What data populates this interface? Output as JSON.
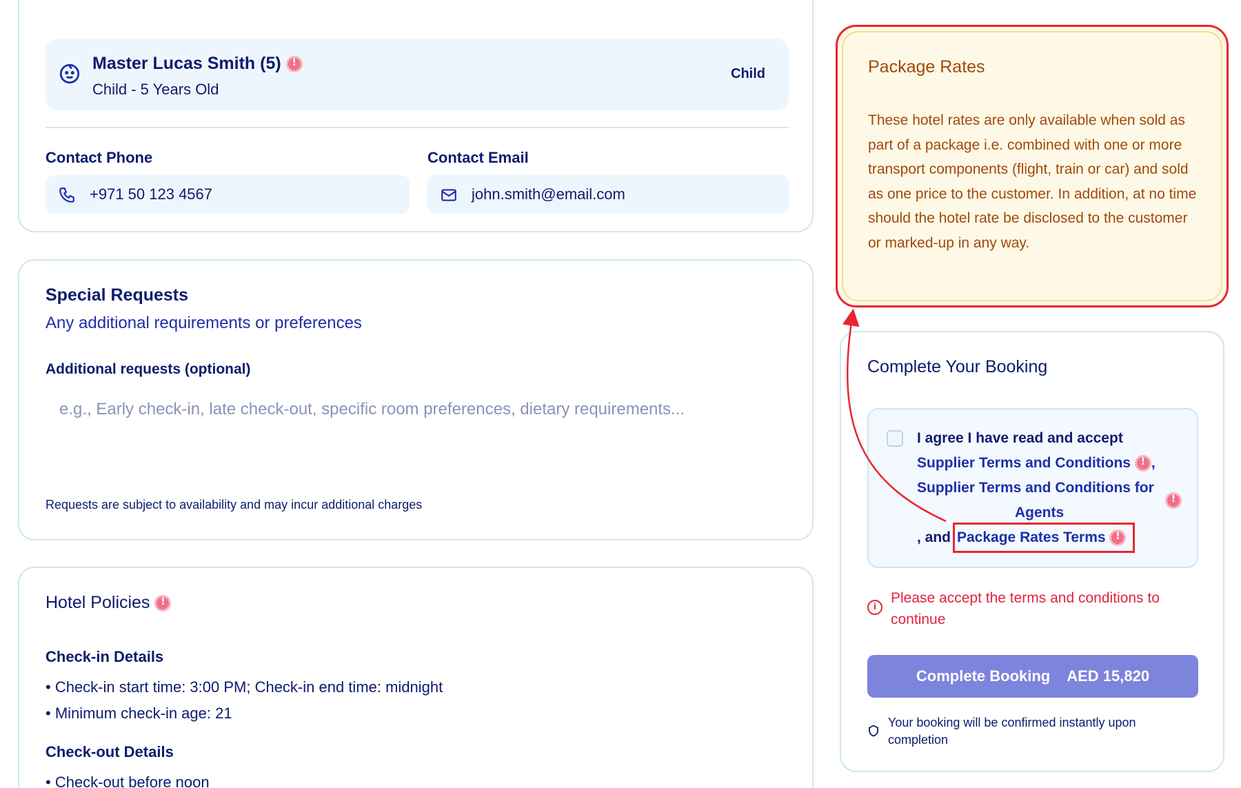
{
  "traveler": {
    "child_name": "Master Lucas Smith (5)",
    "child_subtitle": "Child - 5 Years Old",
    "child_badge": "Child",
    "contact_phone_label": "Contact Phone",
    "contact_phone_value": "+971 50 123 4567",
    "contact_email_label": "Contact Email",
    "contact_email_value": "john.smith@email.com"
  },
  "special_requests": {
    "title": "Special Requests",
    "subtitle": "Any additional requirements or preferences",
    "field_label": "Additional requests (optional)",
    "placeholder": "e.g., Early check-in, late check-out, specific room preferences, dietary requirements...",
    "note": "Requests are subject to availability and may incur additional charges"
  },
  "hotel_policies": {
    "title": "Hotel Policies",
    "checkin_heading": "Check-in Details",
    "checkin_items": [
      "• Check-in start time: 3:00 PM; Check-in end time: midnight",
      "• Minimum check-in age: 21"
    ],
    "checkout_heading": "Check-out Details",
    "checkout_items": [
      "• Check-out before noon"
    ]
  },
  "package_rates": {
    "title": "Package Rates",
    "body": "These hotel rates are only available when sold as part of a package i.e. combined with one or more transport components (flight, train or car) and sold as one price to the customer. In addition, at no time should the hotel rate be disclosed to the customer or marked-up in any way."
  },
  "booking": {
    "title": "Complete Your Booking",
    "agree_text": "I agree I have read and accept",
    "supplier_terms": "Supplier Terms and Conditions",
    "comma": ",",
    "agent_terms_line1": "Supplier Terms and Conditions for",
    "agent_terms_line2": "Agents",
    "and_text": ", and",
    "package_terms": "Package Rates Terms",
    "error_text": "Please accept the terms and conditions to continue",
    "button_label": "Complete Booking",
    "button_price": "AED 15,820",
    "confirm_note": "Your booking will be confirmed instantly upon completion"
  },
  "colors": {
    "navy": "#0d1b6e",
    "accent_button": "#7d84dc",
    "error_red": "#e0243f",
    "highlight_red": "#e8262f",
    "package_bg": "#fef9e6",
    "package_text": "#a14a0a"
  },
  "icons": [
    "child-face-icon",
    "info-icon",
    "phone-icon",
    "mail-icon",
    "alert-circle-icon",
    "shield-icon"
  ]
}
